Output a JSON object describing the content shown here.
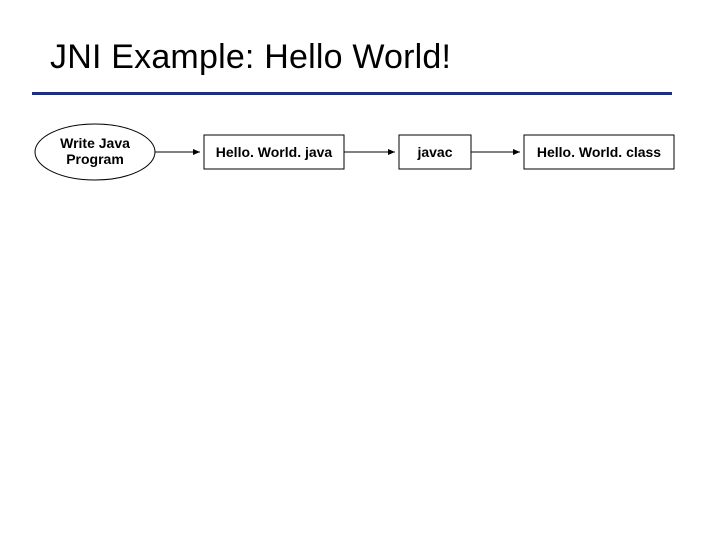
{
  "slide": {
    "title": "JNI Example: Hello World!"
  },
  "flow": {
    "step1_line1": "Write Java",
    "step1_line2": "Program",
    "file1": "Hello. World. java",
    "tool": "javac",
    "file2": "Hello. World. class"
  }
}
